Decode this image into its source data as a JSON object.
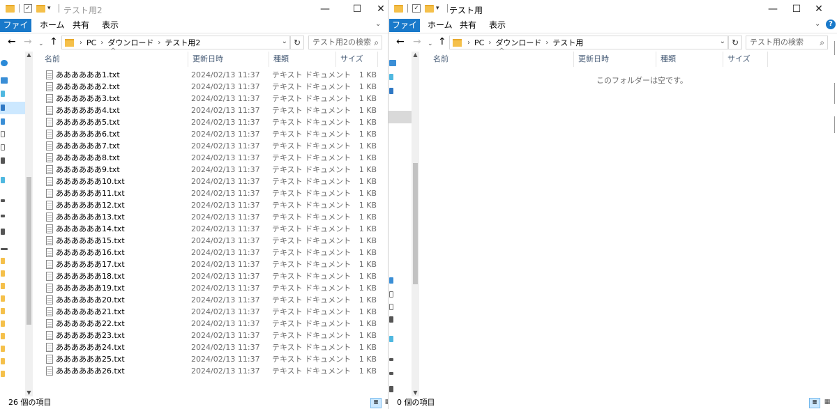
{
  "window1": {
    "title": "テスト用2",
    "ribbon": {
      "file": "ファイル",
      "home": "ホーム",
      "share": "共有",
      "view": "表示"
    },
    "breadcrumb": [
      "PC",
      "ダウンロード",
      "テスト用2"
    ],
    "search_placeholder": "テスト用2の検索",
    "columns": {
      "name": "名前",
      "date": "更新日時",
      "type": "種類",
      "size": "サイズ"
    },
    "files": [
      {
        "name": "ああああああ1.txt",
        "date": "2024/02/13 11:37",
        "type": "テキスト ドキュメント",
        "size": "1 KB"
      },
      {
        "name": "ああああああ2.txt",
        "date": "2024/02/13 11:37",
        "type": "テキスト ドキュメント",
        "size": "1 KB"
      },
      {
        "name": "ああああああ3.txt",
        "date": "2024/02/13 11:37",
        "type": "テキスト ドキュメント",
        "size": "1 KB"
      },
      {
        "name": "ああああああ4.txt",
        "date": "2024/02/13 11:37",
        "type": "テキスト ドキュメント",
        "size": "1 KB"
      },
      {
        "name": "ああああああ5.txt",
        "date": "2024/02/13 11:37",
        "type": "テキスト ドキュメント",
        "size": "1 KB"
      },
      {
        "name": "ああああああ6.txt",
        "date": "2024/02/13 11:37",
        "type": "テキスト ドキュメント",
        "size": "1 KB"
      },
      {
        "name": "ああああああ7.txt",
        "date": "2024/02/13 11:37",
        "type": "テキスト ドキュメント",
        "size": "1 KB"
      },
      {
        "name": "ああああああ8.txt",
        "date": "2024/02/13 11:37",
        "type": "テキスト ドキュメント",
        "size": "1 KB"
      },
      {
        "name": "ああああああ9.txt",
        "date": "2024/02/13 11:37",
        "type": "テキスト ドキュメント",
        "size": "1 KB"
      },
      {
        "name": "ああああああ10.txt",
        "date": "2024/02/13 11:37",
        "type": "テキスト ドキュメント",
        "size": "1 KB"
      },
      {
        "name": "ああああああ11.txt",
        "date": "2024/02/13 11:37",
        "type": "テキスト ドキュメント",
        "size": "1 KB"
      },
      {
        "name": "ああああああ12.txt",
        "date": "2024/02/13 11:37",
        "type": "テキスト ドキュメント",
        "size": "1 KB"
      },
      {
        "name": "ああああああ13.txt",
        "date": "2024/02/13 11:37",
        "type": "テキスト ドキュメント",
        "size": "1 KB"
      },
      {
        "name": "ああああああ14.txt",
        "date": "2024/02/13 11:37",
        "type": "テキスト ドキュメント",
        "size": "1 KB"
      },
      {
        "name": "ああああああ15.txt",
        "date": "2024/02/13 11:37",
        "type": "テキスト ドキュメント",
        "size": "1 KB"
      },
      {
        "name": "ああああああ16.txt",
        "date": "2024/02/13 11:37",
        "type": "テキスト ドキュメント",
        "size": "1 KB"
      },
      {
        "name": "ああああああ17.txt",
        "date": "2024/02/13 11:37",
        "type": "テキスト ドキュメント",
        "size": "1 KB"
      },
      {
        "name": "ああああああ18.txt",
        "date": "2024/02/13 11:37",
        "type": "テキスト ドキュメント",
        "size": "1 KB"
      },
      {
        "name": "ああああああ19.txt",
        "date": "2024/02/13 11:37",
        "type": "テキスト ドキュメント",
        "size": "1 KB"
      },
      {
        "name": "ああああああ20.txt",
        "date": "2024/02/13 11:37",
        "type": "テキスト ドキュメント",
        "size": "1 KB"
      },
      {
        "name": "ああああああ21.txt",
        "date": "2024/02/13 11:37",
        "type": "テキスト ドキュメント",
        "size": "1 KB"
      },
      {
        "name": "ああああああ22.txt",
        "date": "2024/02/13 11:37",
        "type": "テキスト ドキュメント",
        "size": "1 KB"
      },
      {
        "name": "ああああああ23.txt",
        "date": "2024/02/13 11:37",
        "type": "テキスト ドキュメント",
        "size": "1 KB"
      },
      {
        "name": "ああああああ24.txt",
        "date": "2024/02/13 11:37",
        "type": "テキスト ドキュメント",
        "size": "1 KB"
      },
      {
        "name": "ああああああ25.txt",
        "date": "2024/02/13 11:37",
        "type": "テキスト ドキュメント",
        "size": "1 KB"
      },
      {
        "name": "ああああああ26.txt",
        "date": "2024/02/13 11:37",
        "type": "テキスト ドキュメント",
        "size": "1 KB"
      }
    ],
    "status": "26 個の項目"
  },
  "window2": {
    "title": "テスト用",
    "ribbon": {
      "file": "ファイル",
      "home": "ホーム",
      "share": "共有",
      "view": "表示"
    },
    "breadcrumb": [
      "PC",
      "ダウンロード",
      "テスト用"
    ],
    "search_placeholder": "テスト用の検索",
    "columns": {
      "name": "名前",
      "date": "更新日時",
      "type": "種類",
      "size": "サイズ"
    },
    "empty_message": "このフォルダーは空です。",
    "status": "0 個の項目"
  },
  "colors": {
    "accent": "#1979ca",
    "folder": "#f5c04a",
    "header_text": "#4c607a",
    "selection": "#cce8ff"
  },
  "icons": {
    "minimize": "—",
    "maximize": "☐",
    "close": "✕",
    "back": "←",
    "forward": "→",
    "up": "↑",
    "refresh": "↻",
    "search": "⌕",
    "chevron": "›",
    "dropdown": "⌄",
    "help": "?"
  }
}
